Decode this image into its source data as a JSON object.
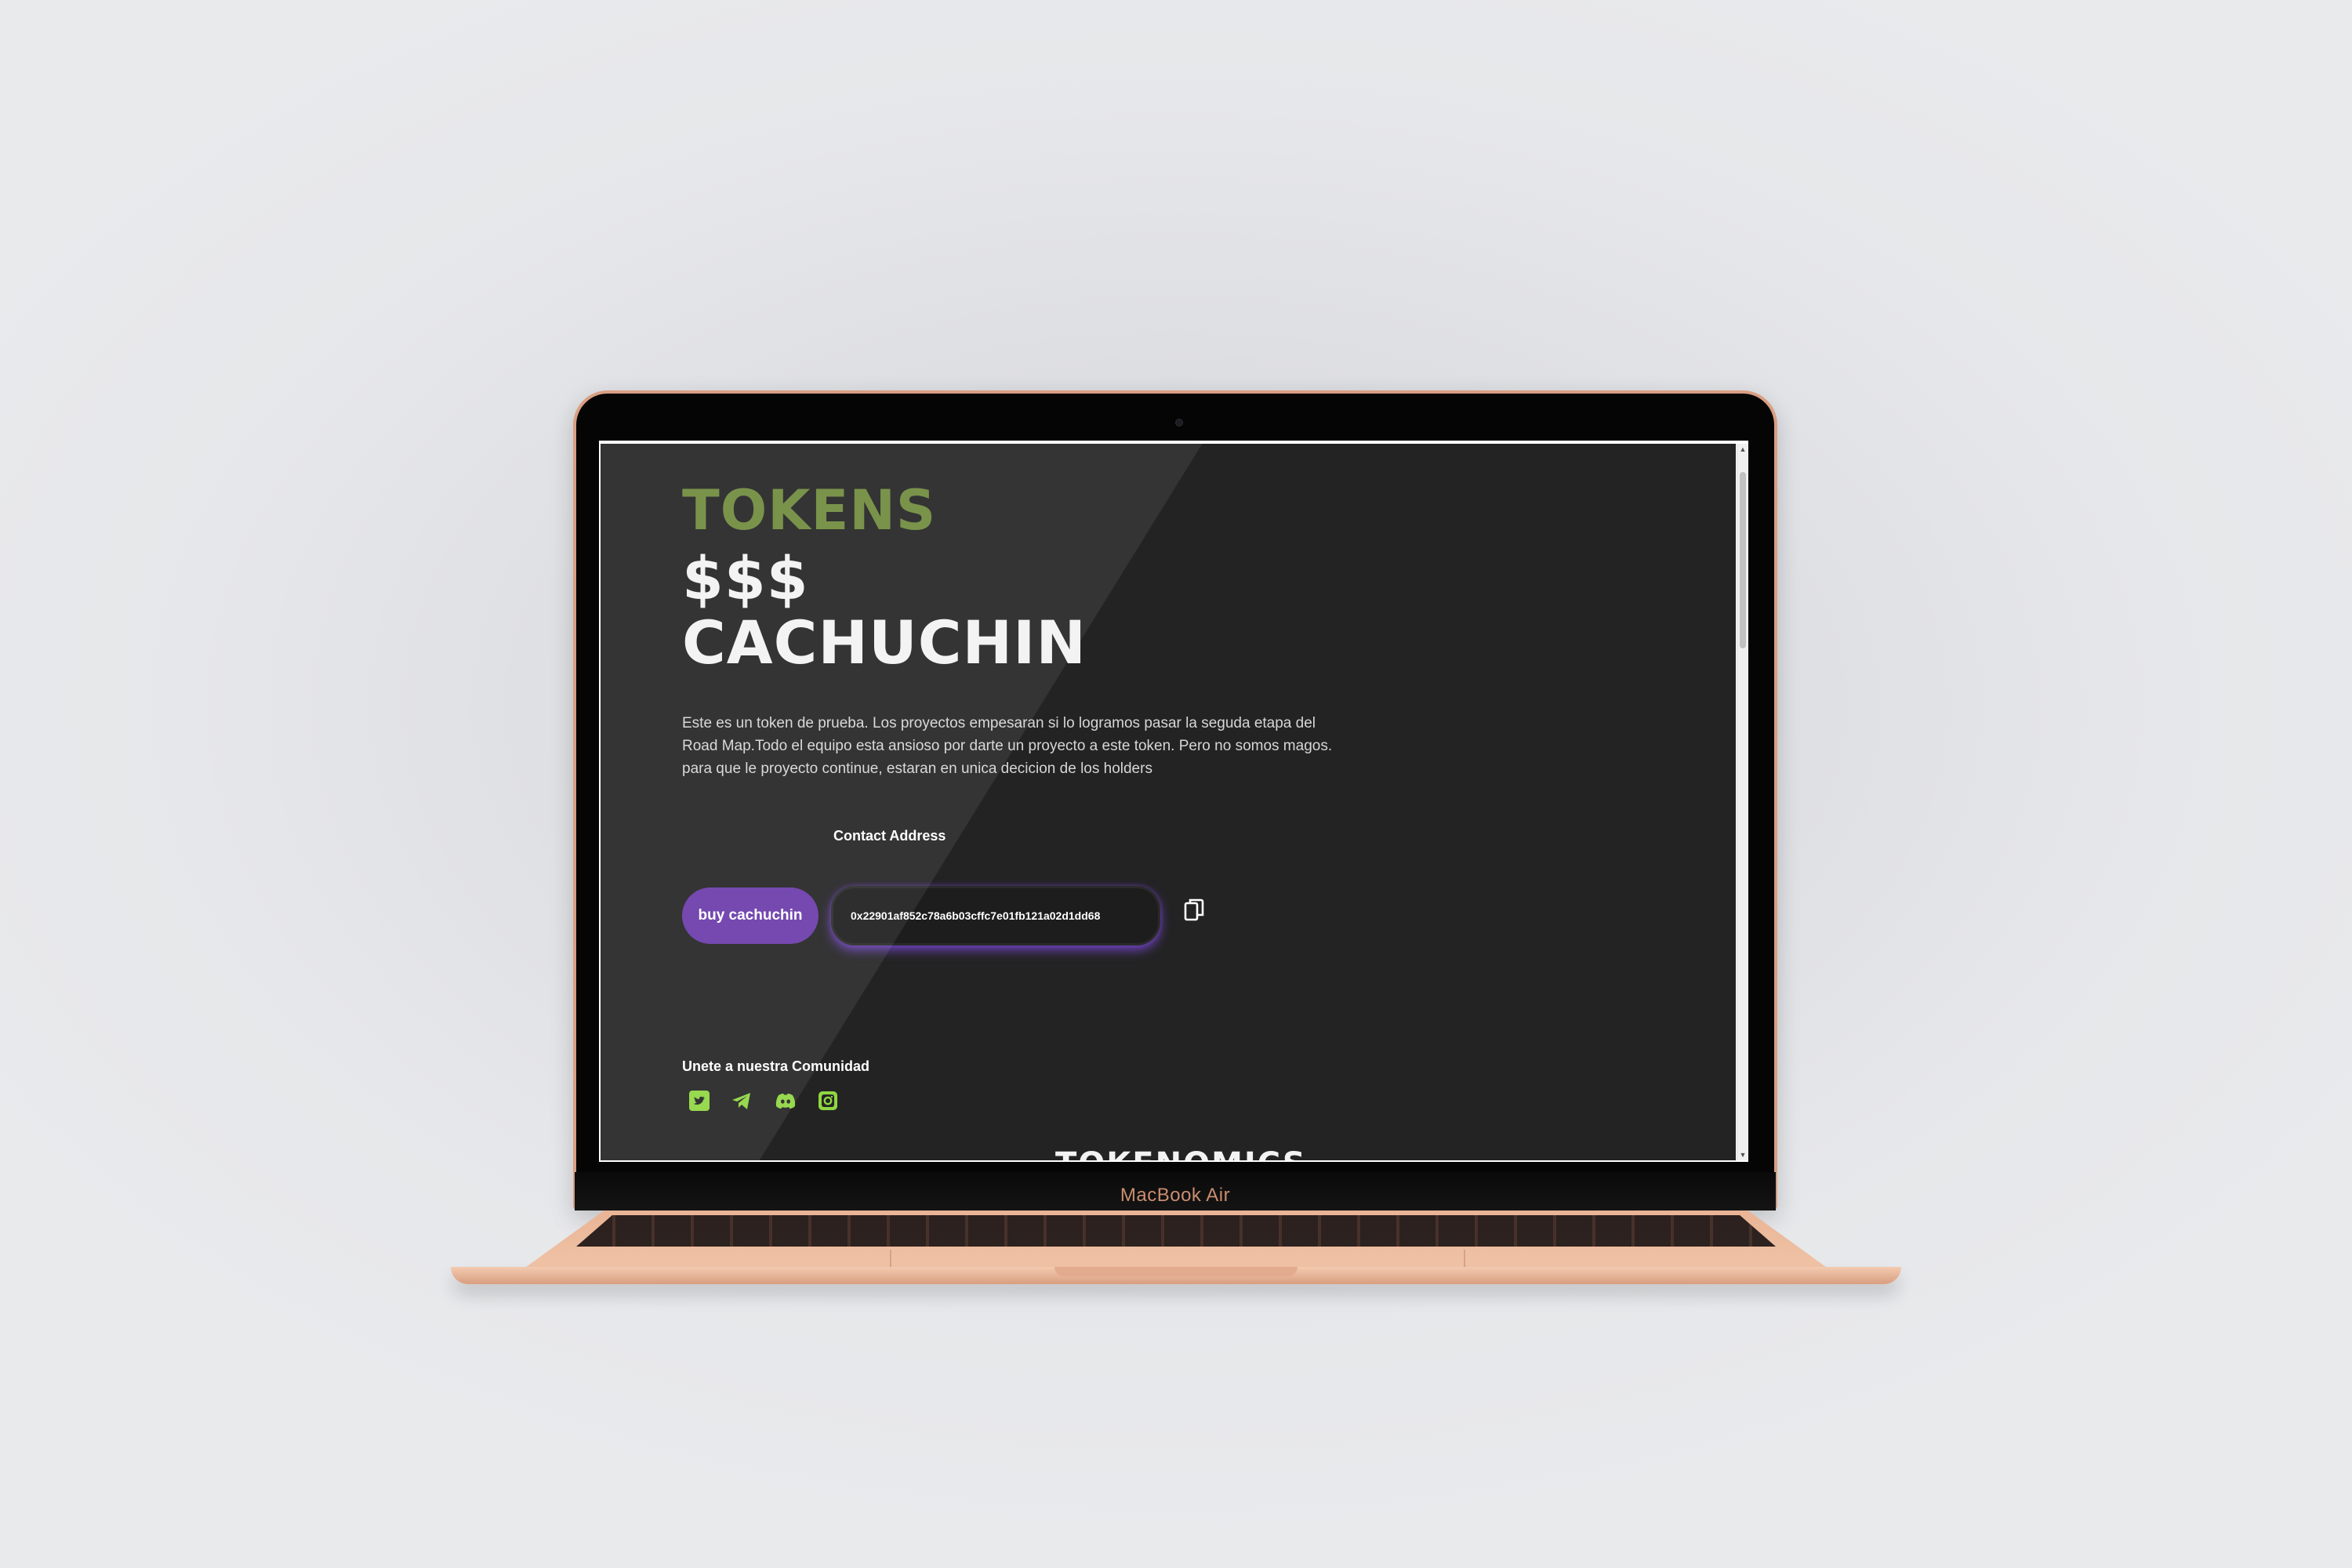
{
  "device": {
    "model_label": "MacBook Air"
  },
  "hero": {
    "title_line1": "TOKENS",
    "title_line2": "$$$",
    "title_line3": "CACHUCHIN",
    "description": "Este es un token de prueba. Los proyectos empesaran si lo logramos pasar la seguda etapa del Road Map.Todo el equipo esta ansioso por darte un proyecto a este token. Pero no somos magos. para que le proyecto continue, estaran en unica decicion de los holders"
  },
  "contract": {
    "label": "Contact Address",
    "address": "0x22901af852c78a6b03cffc7e01fb121a02d1dd68",
    "buy_label": "buy cachuchin",
    "copy_icon": "copy-icon"
  },
  "community": {
    "label": "Unete a nuestra Comunidad",
    "icons": [
      "twitter-icon",
      "telegram-icon",
      "discord-icon",
      "instagram-icon"
    ],
    "icon_color": "#8fd641"
  },
  "next_section": {
    "title": "TOKENOMICS"
  },
  "colors": {
    "accent_green": "#6f8a3c",
    "button_purple": "#6a3aaa",
    "page_background": "#232323"
  }
}
